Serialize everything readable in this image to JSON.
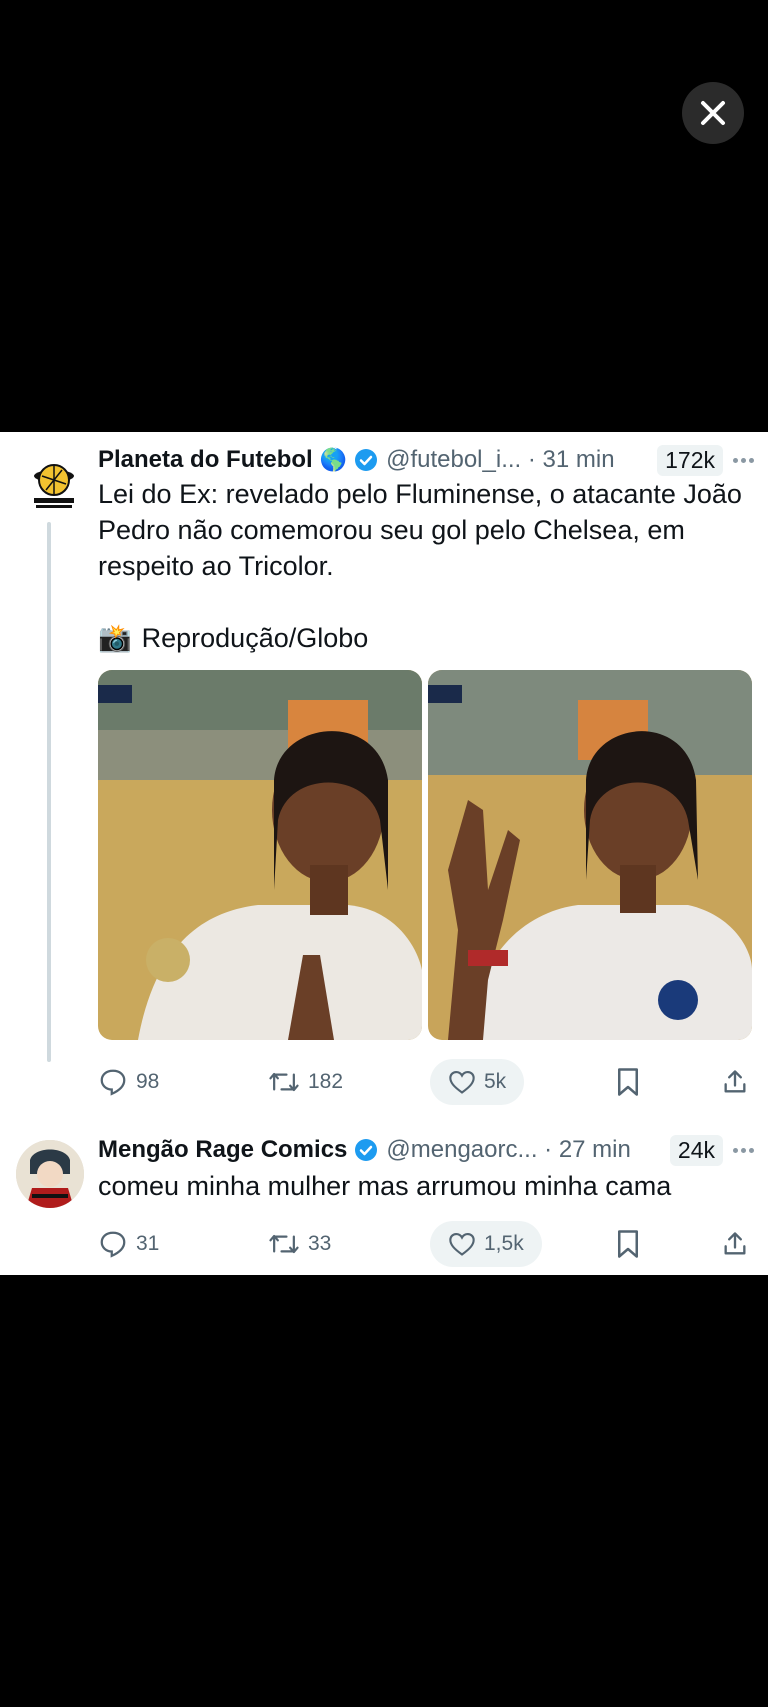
{
  "viewer": {
    "close_icon": "close-icon"
  },
  "tweets": [
    {
      "author": "Planeta do Futebol",
      "emoji": "🌎",
      "verified": true,
      "handle": "@futebol_i...",
      "time": "· 31 min",
      "views": "172k",
      "text": "Lei do Ex: revelado pelo Fluminense, o atacante João Pedro não comemorou seu gol pelo Chelsea, em respeito ao Tricolor.",
      "credit_emoji": "📸",
      "credit": "Reprodução/Globo",
      "actions": {
        "replies": "98",
        "retweets": "182",
        "likes": "5k"
      }
    },
    {
      "author": "Mengão Rage Comics",
      "verified": true,
      "handle": "@mengaorc...",
      "time": "· 27 min",
      "views": "24k",
      "text": "comeu minha mulher mas arrumou minha cama",
      "actions": {
        "replies": "31",
        "retweets": "33",
        "likes": "1,5k"
      }
    }
  ],
  "colors": {
    "verified": "#1d9bf0",
    "muted": "#536471",
    "text": "#0f1419"
  }
}
